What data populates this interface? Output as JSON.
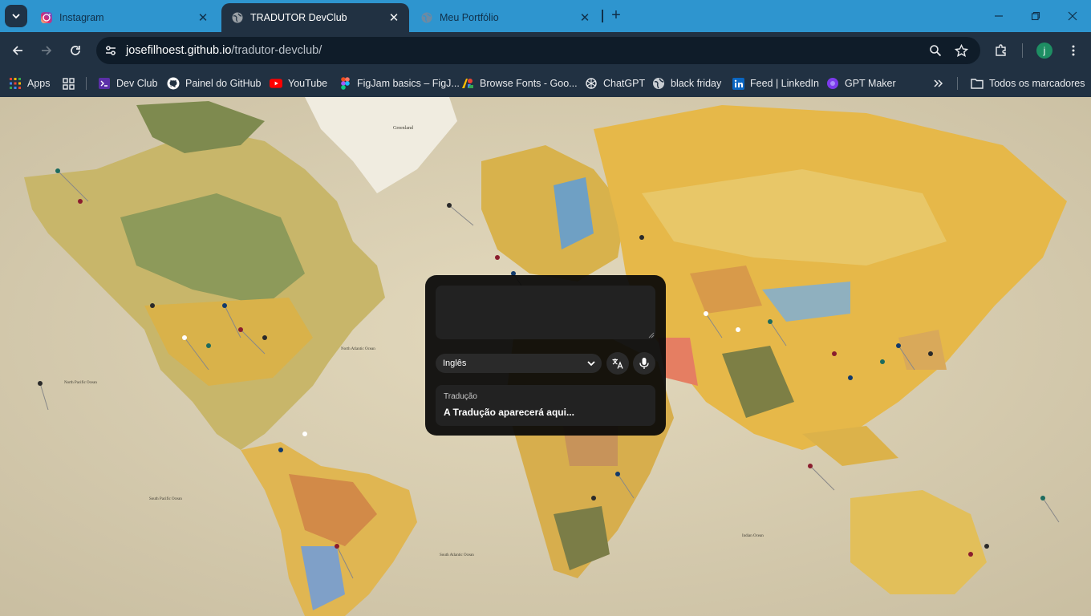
{
  "browser": {
    "tabs": [
      {
        "title": "Instagram",
        "favicon": "instagram-icon",
        "active": false
      },
      {
        "title": "TRADUTOR DevClub",
        "favicon": "globe-icon",
        "active": true
      },
      {
        "title": "Meu Portfólio",
        "favicon": "globe-icon",
        "active": false
      }
    ],
    "url_host": "josefilhoest.github.io",
    "url_path": "/tradutor-devclub/",
    "profile_initial": "j",
    "colors": {
      "tabstrip": "#2e95cf",
      "toolbar": "#213142",
      "omnibox": "#0f1c29"
    }
  },
  "bookmarks": {
    "items": [
      {
        "label": "Apps",
        "icon": "apps-grid-icon"
      },
      {
        "label": "Dev Club",
        "icon": "devclub-icon"
      },
      {
        "label": "Painel do GitHub",
        "icon": "github-icon"
      },
      {
        "label": "YouTube",
        "icon": "youtube-icon"
      },
      {
        "label": "FigJam basics – FigJ...",
        "icon": "figma-icon"
      },
      {
        "label": "Browse Fonts - Goo...",
        "icon": "google-fonts-icon"
      },
      {
        "label": "ChatGPT",
        "icon": "chatgpt-icon"
      },
      {
        "label": "black friday",
        "icon": "globe-icon"
      },
      {
        "label": "Feed | LinkedIn",
        "icon": "linkedin-icon"
      },
      {
        "label": "GPT Maker",
        "icon": "gptmaker-icon"
      }
    ],
    "all_bookmarks": "Todos os marcadores"
  },
  "translator": {
    "input_value": "",
    "language": "Inglês",
    "translate_icon": "translate-icon",
    "mic_icon": "microphone-icon",
    "result_label": "Tradução",
    "result_text": "A Tradução aparecerá aqui..."
  },
  "map_labels": {
    "greenland": "Greenland",
    "north_pacific": "North Pacific Ocean",
    "north_atlantic": "North Atlantic Ocean",
    "south_pacific": "South Pacific Ocean",
    "south_atlantic": "South Atlantic Ocean",
    "indian": "Indian Ocean"
  }
}
